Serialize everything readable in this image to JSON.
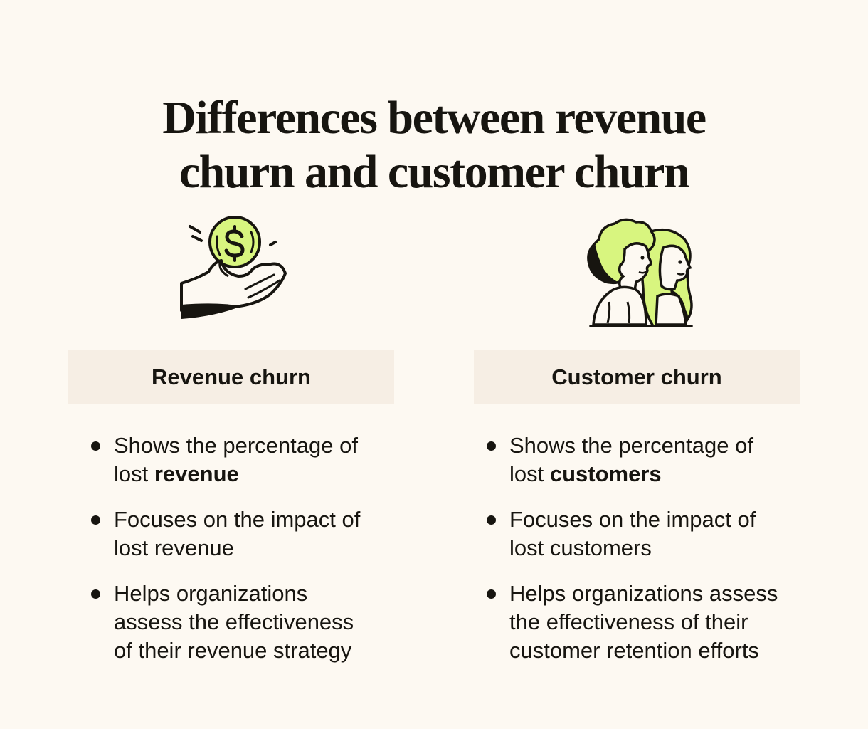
{
  "title": {
    "line1": "Differences between revenue",
    "line2": "churn and customer churn"
  },
  "colors": {
    "background": "#fdf9f2",
    "header_box": "#f6eee4",
    "text": "#171510",
    "accent_green": "#d8f57f"
  },
  "columns": [
    {
      "icon": "hand-holding-coin-icon",
      "header": "Revenue churn",
      "bullets": [
        {
          "line1": "Shows the percentage of",
          "line2_prefix": "lost ",
          "line2_bold": "revenue"
        },
        {
          "line1": "Focuses on the impact of",
          "line2": "lost revenue"
        },
        {
          "line1": "Helps organizations",
          "line2": "assess the effectiveness",
          "line3": "of their revenue strategy"
        }
      ]
    },
    {
      "icon": "two-people-icon",
      "header": "Customer churn",
      "bullets": [
        {
          "line1": "Shows the percentage of",
          "line2_prefix": "lost ",
          "line2_bold": "customers"
        },
        {
          "line1": "Focuses on the impact of",
          "line2": "lost customers"
        },
        {
          "line1": "Helps organizations assess",
          "line2": "the effectiveness of their",
          "line3": "customer retention efforts"
        }
      ]
    }
  ]
}
